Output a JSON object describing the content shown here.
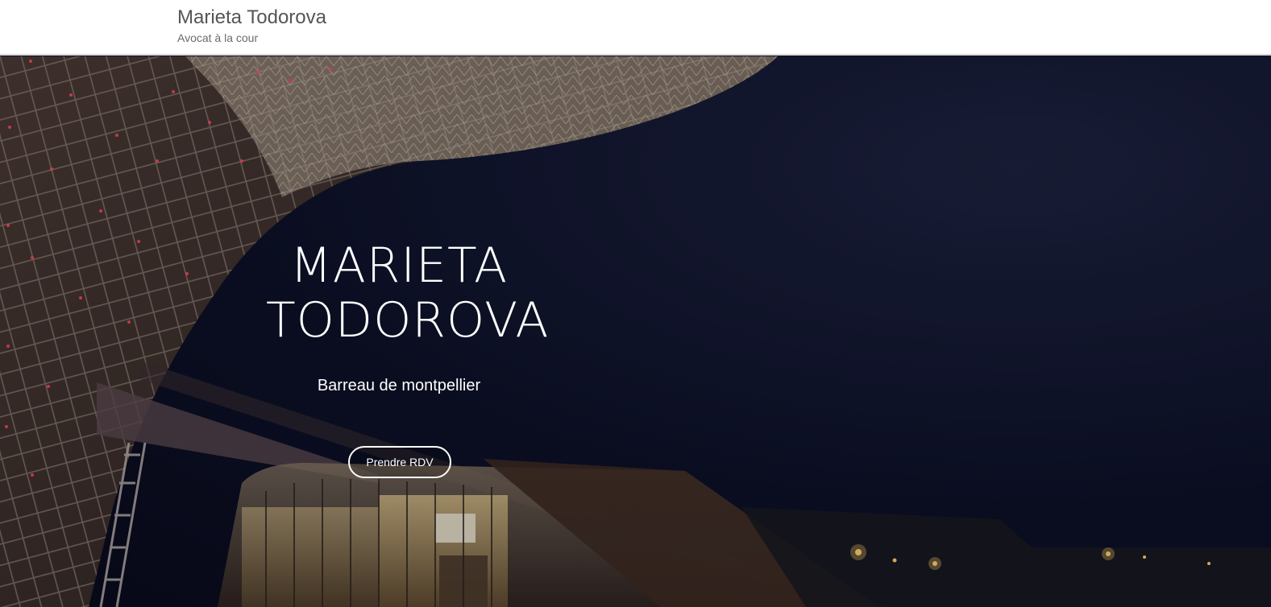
{
  "header": {
    "title": "Marieta Todorova",
    "tagline": "Avocat à la cour"
  },
  "hero": {
    "title_line1": "MARIETA",
    "title_line2": "TODOROVA",
    "subtitle": "Barreau de montpellier",
    "cta_label": "Prendre RDV"
  },
  "colors": {
    "header_bg": "#ffffff",
    "title_text": "#555555",
    "hero_bg": "#0e1226",
    "hero_text": "#ffffff"
  }
}
